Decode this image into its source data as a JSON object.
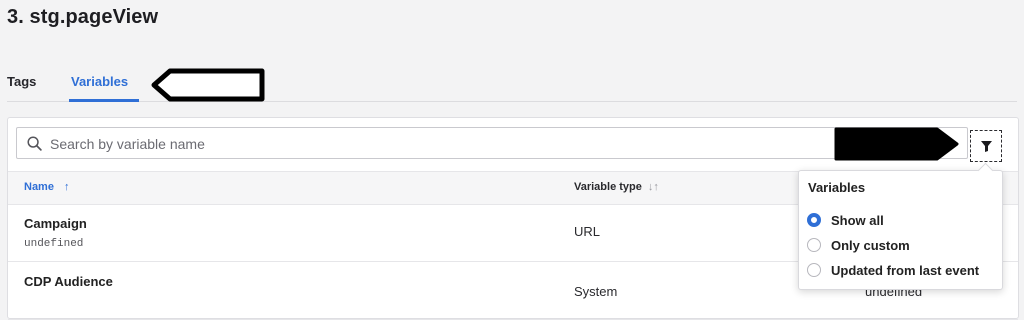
{
  "page": {
    "title": "3. stg.pageView"
  },
  "tabs": [
    {
      "label": "Tags",
      "active": false
    },
    {
      "label": "Variables",
      "active": true
    }
  ],
  "search": {
    "placeholder": "Search by variable name",
    "value": ""
  },
  "table": {
    "columns": [
      {
        "label": "Name",
        "sort": "↑"
      },
      {
        "label": "Variable type",
        "sort": "↓↑"
      }
    ],
    "rows": [
      {
        "name": "Campaign",
        "sub": "undefined",
        "type": "URL",
        "extra": ""
      },
      {
        "name": "CDP Audience",
        "sub": "",
        "type": "System",
        "extra": "undefined"
      }
    ]
  },
  "filter_popover": {
    "title": "Variables",
    "options": [
      {
        "label": "Show all",
        "checked": true
      },
      {
        "label": "Only custom",
        "checked": false
      },
      {
        "label": "Updated from last event",
        "checked": false
      }
    ]
  },
  "colors": {
    "accent": "#2f6fd6",
    "redaction": "#000000"
  },
  "icons": {
    "search": "search-icon",
    "filter": "filter-funnel-icon"
  }
}
